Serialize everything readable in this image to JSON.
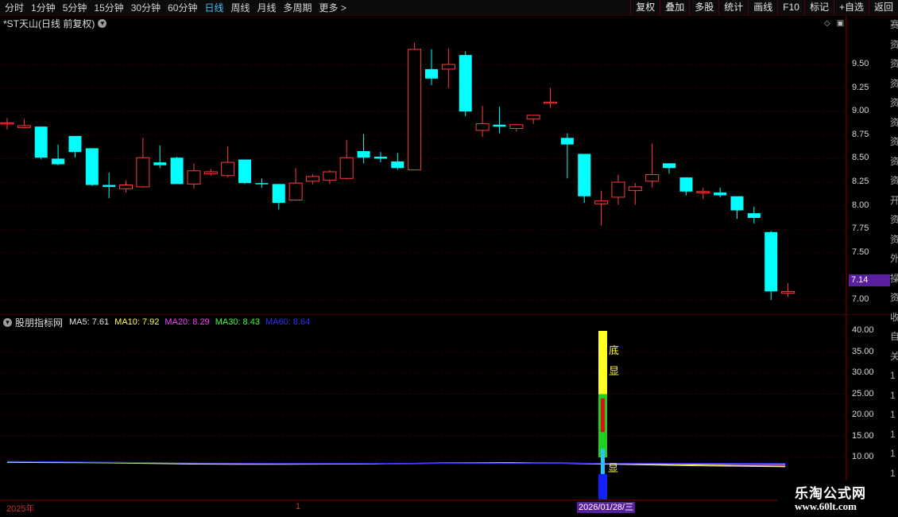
{
  "toolbar": {
    "periods": [
      "分时",
      "1分钟",
      "5分钟",
      "15分钟",
      "30分钟",
      "60分钟",
      "日线",
      "周线",
      "月线",
      "多周期",
      "更多 >"
    ],
    "active_period": "日线",
    "tools": [
      "复权",
      "叠加",
      "多股",
      "统计",
      "画线",
      "F10",
      "标记",
      "+自选",
      "返回"
    ]
  },
  "main": {
    "title": "*ST天山(日线 前复权)",
    "last_price": "7.14",
    "y_ticks": [
      "9.50",
      "9.25",
      "9.00",
      "8.75",
      "8.50",
      "8.25",
      "8.00",
      "7.75",
      "7.50",
      "7.00"
    ]
  },
  "indicator": {
    "name": "股朋指标网",
    "ma": [
      {
        "label": "MA5: 7.61",
        "color": "#e0e0e0"
      },
      {
        "label": "MA10: 7.92",
        "color": "#ffff40"
      },
      {
        "label": "MA20: 8.29",
        "color": "#ff40ff"
      },
      {
        "label": "MA30: 8.43",
        "color": "#40ff40"
      },
      {
        "label": "MA60: 8.64",
        "color": "#2f2fff"
      }
    ],
    "y_ticks": [
      "40.00",
      "35.00",
      "30.00",
      "25.00",
      "20.00",
      "15.00",
      "10.00"
    ],
    "signals": [
      "底",
      "显",
      "显"
    ]
  },
  "xaxis": {
    "year_label": "2025年",
    "month_label": "1",
    "cursor_date": "2026/01/28/三"
  },
  "right_strip": [
    "赛",
    "资",
    "资",
    "资",
    "资",
    "资",
    "资",
    "资",
    "资",
    "开",
    "资",
    "资",
    "外",
    "操",
    "资",
    "收",
    "自",
    "关",
    "1",
    "1",
    "1",
    "1",
    "1",
    "1",
    "1"
  ],
  "logo": {
    "name": "乐淘公式网",
    "url": "www.60lt.com"
  },
  "chart_data": {
    "type": "candlestick",
    "candles": [
      {
        "o": 8.88,
        "c": 8.88,
        "h": 8.93,
        "l": 8.81
      },
      {
        "o": 8.83,
        "c": 8.85,
        "h": 8.92,
        "l": 8.82
      },
      {
        "o": 8.84,
        "c": 8.51,
        "h": 8.84,
        "l": 8.49
      },
      {
        "o": 8.5,
        "c": 8.44,
        "h": 8.65,
        "l": 8.43
      },
      {
        "o": 8.74,
        "c": 8.57,
        "h": 8.74,
        "l": 8.51
      },
      {
        "o": 8.61,
        "c": 8.22,
        "h": 8.61,
        "l": 8.21
      },
      {
        "o": 8.22,
        "c": 8.2,
        "h": 8.35,
        "l": 8.08
      },
      {
        "o": 8.18,
        "c": 8.22,
        "h": 8.27,
        "l": 8.14
      },
      {
        "o": 8.2,
        "c": 8.51,
        "h": 8.72,
        "l": 8.19
      },
      {
        "o": 8.46,
        "c": 8.43,
        "h": 8.64,
        "l": 8.4
      },
      {
        "o": 8.51,
        "c": 8.23,
        "h": 8.52,
        "l": 8.23
      },
      {
        "o": 8.23,
        "c": 8.37,
        "h": 8.45,
        "l": 8.18
      },
      {
        "o": 8.34,
        "c": 8.36,
        "h": 8.39,
        "l": 8.32
      },
      {
        "o": 8.32,
        "c": 8.46,
        "h": 8.63,
        "l": 8.3
      },
      {
        "o": 8.49,
        "c": 8.24,
        "h": 8.49,
        "l": 8.23
      },
      {
        "o": 8.24,
        "c": 8.23,
        "h": 8.29,
        "l": 8.19
      },
      {
        "o": 8.23,
        "c": 8.03,
        "h": 8.23,
        "l": 7.96
      },
      {
        "o": 8.06,
        "c": 8.24,
        "h": 8.4,
        "l": 8.05
      },
      {
        "o": 8.26,
        "c": 8.31,
        "h": 8.33,
        "l": 8.23
      },
      {
        "o": 8.27,
        "c": 8.36,
        "h": 8.38,
        "l": 8.23
      },
      {
        "o": 8.29,
        "c": 8.51,
        "h": 8.7,
        "l": 8.28
      },
      {
        "o": 8.58,
        "c": 8.51,
        "h": 8.76,
        "l": 8.45
      },
      {
        "o": 8.52,
        "c": 8.5,
        "h": 8.57,
        "l": 8.46
      },
      {
        "o": 8.47,
        "c": 8.4,
        "h": 8.56,
        "l": 8.38
      },
      {
        "o": 8.38,
        "c": 9.66,
        "h": 9.73,
        "l": 8.38
      },
      {
        "o": 9.45,
        "c": 9.35,
        "h": 9.66,
        "l": 9.28
      },
      {
        "o": 9.45,
        "c": 9.5,
        "h": 9.67,
        "l": 9.25
      },
      {
        "o": 9.6,
        "c": 9.0,
        "h": 9.64,
        "l": 8.95
      },
      {
        "o": 8.8,
        "c": 8.87,
        "h": 9.06,
        "l": 8.73
      },
      {
        "o": 8.86,
        "c": 8.84,
        "h": 9.05,
        "l": 8.77
      },
      {
        "o": 8.82,
        "c": 8.86,
        "h": 8.87,
        "l": 8.79
      },
      {
        "o": 8.92,
        "c": 8.96,
        "h": 8.96,
        "l": 8.87
      },
      {
        "o": 9.1,
        "c": 9.1,
        "h": 9.25,
        "l": 9.04
      },
      {
        "o": 8.72,
        "c": 8.65,
        "h": 8.77,
        "l": 8.29
      },
      {
        "o": 8.55,
        "c": 8.1,
        "h": 8.55,
        "l": 8.03
      },
      {
        "o": 8.02,
        "c": 8.05,
        "h": 8.16,
        "l": 7.79
      },
      {
        "o": 8.09,
        "c": 8.25,
        "h": 8.33,
        "l": 8.01
      },
      {
        "o": 8.16,
        "c": 8.2,
        "h": 8.24,
        "l": 8.01
      },
      {
        "o": 8.26,
        "c": 8.33,
        "h": 8.66,
        "l": 8.19
      },
      {
        "o": 8.45,
        "c": 8.4,
        "h": 8.45,
        "l": 8.34
      },
      {
        "o": 8.3,
        "c": 8.15,
        "h": 8.3,
        "l": 8.11
      },
      {
        "o": 8.14,
        "c": 8.15,
        "h": 8.19,
        "l": 8.07
      },
      {
        "o": 8.14,
        "c": 8.11,
        "h": 8.19,
        "l": 8.09
      },
      {
        "o": 8.1,
        "c": 7.95,
        "h": 8.1,
        "l": 7.86
      },
      {
        "o": 7.92,
        "c": 7.87,
        "h": 7.99,
        "l": 7.81
      },
      {
        "o": 7.72,
        "c": 7.09,
        "h": 7.73,
        "l": 7.0
      },
      {
        "o": 7.07,
        "c": 7.09,
        "h": 7.18,
        "l": 7.03
      }
    ],
    "indicator_bars": [
      {
        "from": 25,
        "to": 40,
        "color": "#ffff20"
      },
      {
        "from": 10,
        "to": 25,
        "color": "#20d020"
      },
      {
        "from": 16,
        "to": 24,
        "color": "#e01010"
      },
      {
        "from": 6,
        "to": 12,
        "color": "#30c0ff"
      },
      {
        "from": 0,
        "to": 6,
        "color": "#1020ff"
      }
    ],
    "indicator_ylim": [
      0,
      40
    ],
    "indicator_lines": [
      {
        "color": "#e0e0e0",
        "values": [
          8.8,
          8.75,
          8.7,
          8.55,
          8.4,
          8.35,
          8.35,
          8.4,
          8.45,
          8.6,
          8.7,
          8.75,
          8.6,
          8.4,
          8.2,
          8.0,
          7.9,
          7.75
        ]
      },
      {
        "color": "#ffff40",
        "values": [
          8.9,
          8.85,
          8.75,
          8.65,
          8.5,
          8.45,
          8.4,
          8.45,
          8.5,
          8.55,
          8.65,
          8.7,
          8.65,
          8.55,
          8.35,
          8.2,
          8.05,
          7.92
        ]
      },
      {
        "color": "#ff40ff",
        "values": [
          9.0,
          8.95,
          8.85,
          8.75,
          8.6,
          8.5,
          8.45,
          8.45,
          8.5,
          8.55,
          8.6,
          8.6,
          8.6,
          8.55,
          8.5,
          8.4,
          8.35,
          8.29
        ]
      },
      {
        "color": "#40ff40",
        "values": [
          8.9,
          8.85,
          8.8,
          8.7,
          8.6,
          8.55,
          8.5,
          8.5,
          8.5,
          8.55,
          8.6,
          8.6,
          8.6,
          8.55,
          8.55,
          8.5,
          8.45,
          8.43
        ]
      },
      {
        "color": "#2f2fff",
        "values": [
          9.1,
          9.05,
          8.95,
          8.85,
          8.75,
          8.7,
          8.65,
          8.65,
          8.65,
          8.65,
          8.7,
          8.7,
          8.7,
          8.65,
          8.65,
          8.65,
          8.64,
          8.64
        ]
      }
    ],
    "ylim": [
      7.0,
      9.75
    ]
  }
}
